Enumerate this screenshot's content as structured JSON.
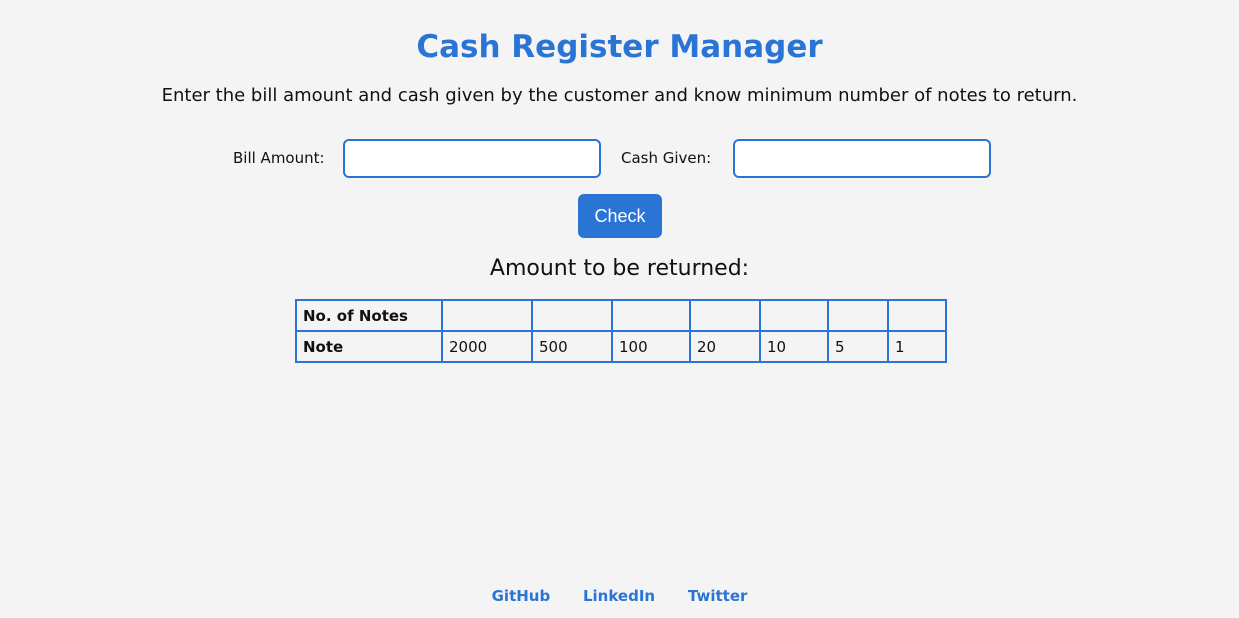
{
  "header": {
    "title": "Cash Register Manager",
    "subtitle": "Enter the bill amount and cash given by the customer and know minimum number of notes to return."
  },
  "form": {
    "bill_label": "Bill Amount:",
    "bill_value": "",
    "cash_label": "Cash Given:",
    "cash_value": "",
    "check_label": "Check"
  },
  "result": {
    "heading": "Amount to be returned:",
    "rows": [
      {
        "label": "No. of Notes",
        "cells": [
          "",
          "",
          "",
          "",
          "",
          "",
          ""
        ]
      },
      {
        "label": "Note",
        "cells": [
          "2000",
          "500",
          "100",
          "20",
          "10",
          "5",
          "1"
        ]
      }
    ]
  },
  "footer": {
    "links": [
      "GitHub",
      "LinkedIn",
      "Twitter"
    ]
  },
  "colors": {
    "accent": "#2a74d6",
    "background": "#f4f4f4"
  }
}
